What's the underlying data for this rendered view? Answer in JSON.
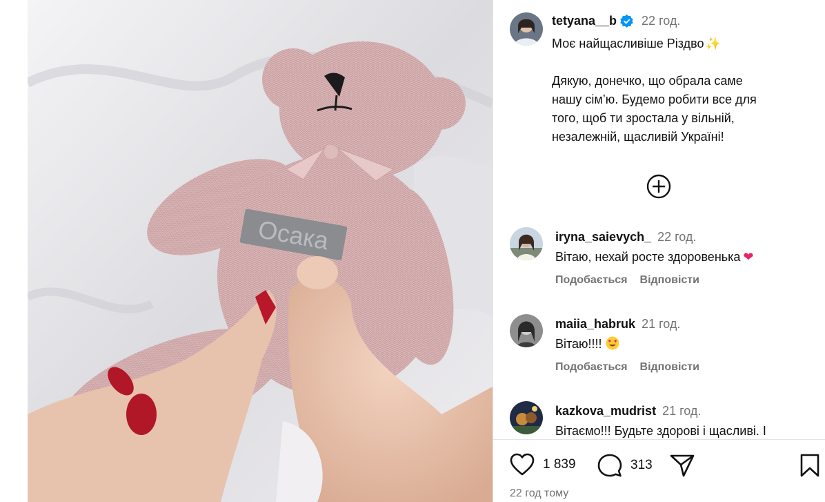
{
  "post": {
    "photo_label": "Осака",
    "author": "tetyana__b",
    "time": "22 год.",
    "caption_title": "Моє найщасливіше Різдво",
    "caption_lines": [
      "Дякую, донечко, що обрала саме",
      "нашу сім’ю. Будемо робити все для",
      "того, щоб ти зростала у вільній,",
      "незалежній, щасливій Україні!"
    ]
  },
  "comments": [
    {
      "user": "iryna_saievych_",
      "time": "22 год.",
      "text": "Вітаю, нехай росте здоровенька",
      "like_label": "Подобається",
      "reply_label": "Відповісти"
    },
    {
      "user": "maiia_habruk",
      "time": "21 год.",
      "text": "Вітаю!!!!",
      "like_label": "Подобається",
      "reply_label": "Відповісти"
    },
    {
      "user": "kazkova_mudrist",
      "time": "21 год.",
      "text": "Вітаємо!!! Будьте здорові і щасливі. І"
    }
  ],
  "actions": {
    "likes": "1 839",
    "comments_count": "313"
  },
  "footer": {
    "time_ago": "22 год тому"
  },
  "icons": {
    "verified": "verified-badge-icon",
    "more": "plus-circle-icon",
    "like": "heart-icon",
    "comment": "comment-bubble-icon",
    "share": "paper-plane-icon",
    "save": "bookmark-icon"
  },
  "colors": {
    "verified": "#0095f6",
    "heart": "#e8245f",
    "muted": "#737373"
  }
}
